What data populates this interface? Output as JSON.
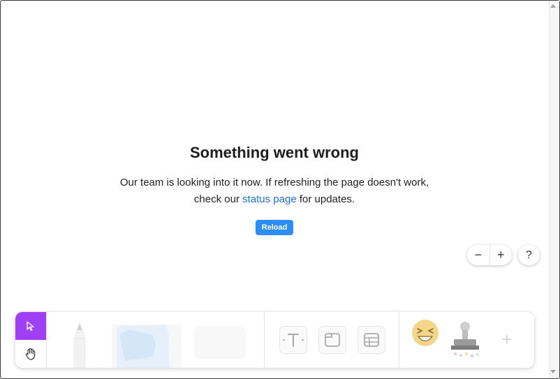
{
  "error": {
    "title": "Something went wrong",
    "message_before_link": "Our team is looking into it now. If refreshing the page doesn't work, check our ",
    "link_text": "status page",
    "message_after_link": " for updates.",
    "reload_label": "Reload"
  },
  "zoom": {
    "zoom_out_symbol": "−",
    "zoom_in_symbol": "+"
  },
  "help": {
    "symbol": "?"
  },
  "toolbar": {
    "add_symbol": "+",
    "tools": [
      {
        "icon": "select-pointer-icon",
        "active": true
      },
      {
        "icon": "hand-pan-icon",
        "active": false
      },
      {
        "icon": "pen-icon",
        "active": false
      },
      {
        "icon": "sticky-note-icon",
        "active": false
      },
      {
        "icon": "shape-icon",
        "active": false
      },
      {
        "icon": "text-icon",
        "active": false
      },
      {
        "icon": "section-icon",
        "active": false
      },
      {
        "icon": "table-icon",
        "active": false
      },
      {
        "icon": "sticker-emoji-icon",
        "active": false
      },
      {
        "icon": "stamp-icon",
        "active": false
      }
    ]
  },
  "colors": {
    "accent": "#9f3ff6",
    "button": "#2d8df7",
    "link": "#1f6fd6"
  }
}
